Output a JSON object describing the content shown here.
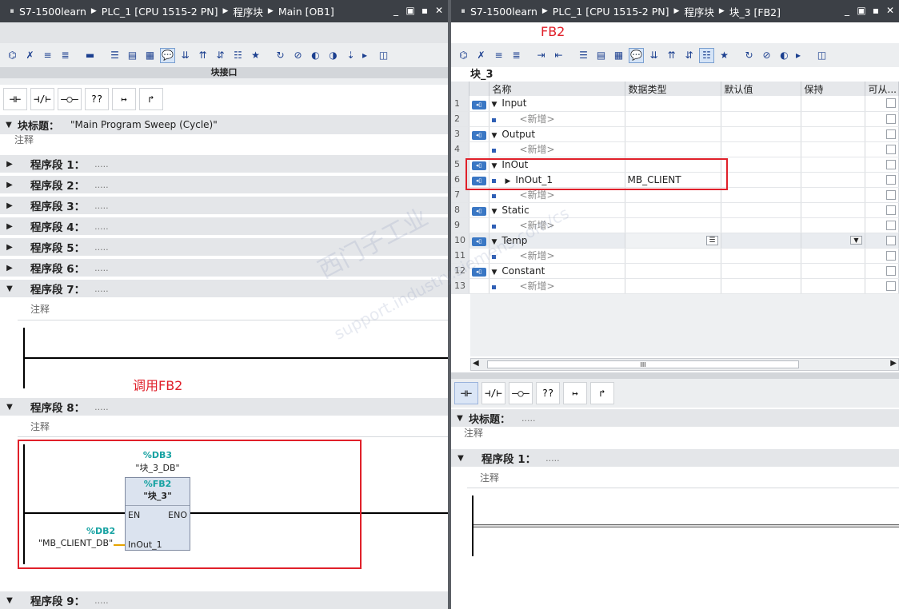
{
  "left": {
    "title": {
      "project": "S7-1500learn",
      "plc": "PLC_1 [CPU 1515-2 PN]",
      "folder": "程序块",
      "block": "Main [OB1]"
    },
    "interface_band": "块接口",
    "ladder_buttons": [
      "⊣⊢",
      "⊣/⊢",
      "–○–",
      "??",
      "↦",
      "↱"
    ],
    "block_title_label": "块标题：",
    "block_title_value": "\"Main Program Sweep (Cycle)\"",
    "block_comment": "注释",
    "networks": [
      {
        "label": "程序段 1：",
        "dots": "....."
      },
      {
        "label": "程序段 2：",
        "dots": "....."
      },
      {
        "label": "程序段 3：",
        "dots": "....."
      },
      {
        "label": "程序段 4：",
        "dots": "....."
      },
      {
        "label": "程序段 5：",
        "dots": "....."
      },
      {
        "label": "程序段 6：",
        "dots": "....."
      },
      {
        "label": "程序段 7：",
        "dots": "....."
      },
      {
        "label": "程序段 8：",
        "dots": "....."
      },
      {
        "label": "程序段 9：",
        "dots": "....."
      }
    ],
    "net7_comment": "注释",
    "annotation": "调用FB2",
    "net8_comment": "注释",
    "fb_call": {
      "db_addr": "%DB3",
      "db_name": "\"块_3_DB\"",
      "fb_addr": "%FB2",
      "fb_name": "\"块_3\"",
      "en": "EN",
      "eno": "ENO",
      "param": "InOut_1",
      "actual_addr": "%DB2",
      "actual_name": "\"MB_CLIENT_DB\""
    }
  },
  "right": {
    "title": {
      "project": "S7-1500learn",
      "plc": "PLC_1 [CPU 1515-2 PN]",
      "folder": "程序块",
      "block": "块_3 [FB2]"
    },
    "annotation": "FB2",
    "block_name": "块_3",
    "columns": [
      "名称",
      "数据类型",
      "默认值",
      "保持",
      "可从..."
    ],
    "rows": [
      {
        "n": "1",
        "name": "Input",
        "type": "",
        "section": true
      },
      {
        "n": "2",
        "name": "<新增>",
        "type": "",
        "section": false,
        "new": true
      },
      {
        "n": "3",
        "name": "Output",
        "type": "",
        "section": true
      },
      {
        "n": "4",
        "name": "<新增>",
        "type": "",
        "section": false,
        "new": true
      },
      {
        "n": "5",
        "name": "InOut",
        "type": "",
        "section": true
      },
      {
        "n": "6",
        "name": "InOut_1",
        "type": "MB_CLIENT",
        "section": false,
        "expand": true
      },
      {
        "n": "7",
        "name": "<新增>",
        "type": "",
        "section": false,
        "new": true
      },
      {
        "n": "8",
        "name": "Static",
        "type": "",
        "section": true
      },
      {
        "n": "9",
        "name": "<新增>",
        "type": "",
        "section": false,
        "new": true
      },
      {
        "n": "10",
        "name": "Temp",
        "type": "",
        "section": true,
        "selected": true
      },
      {
        "n": "11",
        "name": "<新增>",
        "type": "",
        "section": false,
        "new": true
      },
      {
        "n": "12",
        "name": "Constant",
        "type": "",
        "section": true
      },
      {
        "n": "13",
        "name": "<新增>",
        "type": "",
        "section": false,
        "new": true
      }
    ],
    "scroll_mark": "III",
    "ladder_buttons": [
      "⊣⊢",
      "⊣/⊢",
      "–○–",
      "??",
      "↦",
      "↱"
    ],
    "block_title_label": "块标题：",
    "block_title_dots": ".....",
    "block_comment": "注释",
    "network1_label": "程序段 1：",
    "network1_dots": ".....",
    "network1_comment": "注释"
  },
  "watermark": {
    "line1": "西门子工业",
    "line2": "support.industry.siemens.com/cs"
  },
  "colors": {
    "titlebar": "#3c4046",
    "red_annotation": "#e0202a",
    "teal_address": "#16a2a2"
  }
}
